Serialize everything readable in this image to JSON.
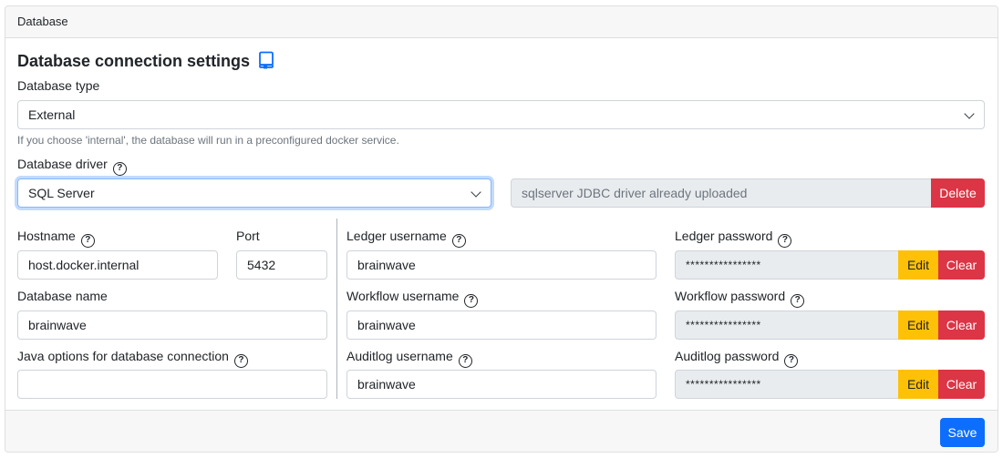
{
  "card": {
    "header": "Database"
  },
  "section": {
    "title": "Database connection settings",
    "icon": "book-icon"
  },
  "db_type": {
    "label": "Database type",
    "value": "External",
    "help": "If you choose 'internal', the database will run in a preconfigured docker service."
  },
  "db_driver": {
    "label": "Database driver",
    "value": "SQL Server",
    "uploaded_text": "sqlserver JDBC driver already uploaded",
    "delete_label": "Delete"
  },
  "hostname": {
    "label": "Hostname",
    "value": "host.docker.internal"
  },
  "port": {
    "label": "Port",
    "value": "5432"
  },
  "db_name": {
    "label": "Database name",
    "value": "brainwave"
  },
  "java_options": {
    "label": "Java options for database connection",
    "value": ""
  },
  "ledger": {
    "username_label": "Ledger username",
    "username": "brainwave",
    "password_label": "Ledger password",
    "password": "****************"
  },
  "workflow": {
    "username_label": "Workflow username",
    "username": "brainwave",
    "password_label": "Workflow password",
    "password": "****************"
  },
  "auditlog": {
    "username_label": "Auditlog username",
    "username": "brainwave",
    "password_label": "Auditlog password",
    "password": "****************"
  },
  "buttons": {
    "edit": "Edit",
    "clear": "Clear",
    "save": "Save"
  },
  "colors": {
    "primary": "#0d6efd",
    "danger": "#dc3545",
    "warning": "#ffc107"
  }
}
